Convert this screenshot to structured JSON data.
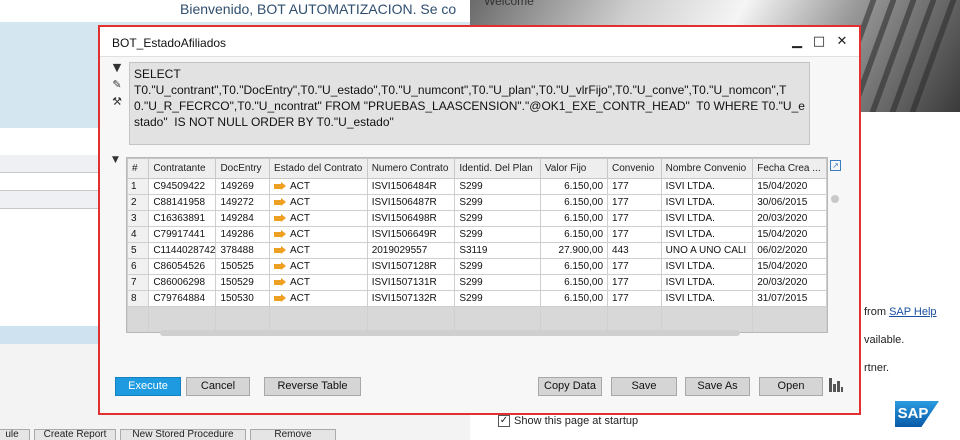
{
  "background": {
    "welcome_text": "Bienvenido, BOT AUTOMATIZACION. Se co",
    "welcome_panel_title": "Welcome",
    "bottom_buttons": [
      "ule",
      "Create Report",
      "New Stored Procedure",
      "Remove"
    ],
    "help_link_prefix": "from",
    "help_link": "SAP Help",
    "line_available": "vailable.",
    "line_partner": "rtner.",
    "show_startup_label": "Show this page at startup",
    "show_startup_checked": true,
    "sap_logo_text": "SAP"
  },
  "dialog": {
    "title": "BOT_EstadoAfiliados",
    "sql": "SELECT\nT0.\"U_contrant\",T0.\"DocEntry\",T0.\"U_estado\",T0.\"U_numcont\",T0.\"U_plan\",T0.\"U_vlrFijo\",T0.\"U_conve\",T0.\"U_nomcon\",T0.\"U_R_FECRCO\",T0.\"U_ncontrat\" FROM \"PRUEBAS_LAASCENSION\".\"@OK1_EXE_CONTR_HEAD\"  T0 WHERE T0.\"U_estado\"  IS NOT NULL ORDER BY T0.\"U_estado\"",
    "grid": {
      "columns": [
        "#",
        "Contratante",
        "DocEntry",
        "Estado del Contrato",
        "Numero Contrato",
        "Identid. Del Plan",
        "Valor Fijo",
        "Convenio",
        "Nombre Convenio",
        "Fecha Crea ..."
      ],
      "rows": [
        [
          "1",
          "C94509422",
          "149269",
          "ACT",
          "ISVI1506484R",
          "S299",
          "6.150,00",
          "177",
          "ISVI LTDA.",
          "15/04/2020"
        ],
        [
          "2",
          "C88141958",
          "149272",
          "ACT",
          "ISVI1506487R",
          "S299",
          "6.150,00",
          "177",
          "ISVI LTDA.",
          "30/06/2015"
        ],
        [
          "3",
          "C16363891",
          "149284",
          "ACT",
          "ISVI1506498R",
          "S299",
          "6.150,00",
          "177",
          "ISVI LTDA.",
          "20/03/2020"
        ],
        [
          "4",
          "C79917441",
          "149286",
          "ACT",
          "ISVI1506649R",
          "S299",
          "6.150,00",
          "177",
          "ISVI LTDA.",
          "15/04/2020"
        ],
        [
          "5",
          "C1144028742",
          "378488",
          "ACT",
          "2019029557",
          "S3119",
          "27.900,00",
          "443",
          "UNO A UNO CALI",
          "06/02/2020"
        ],
        [
          "6",
          "C86054526",
          "150525",
          "ACT",
          "ISVI1507128R",
          "S299",
          "6.150,00",
          "177",
          "ISVI LTDA.",
          "15/04/2020"
        ],
        [
          "7",
          "C86006298",
          "150529",
          "ACT",
          "ISVI1507131R",
          "S299",
          "6.150,00",
          "177",
          "ISVI LTDA.",
          "20/03/2020"
        ],
        [
          "8",
          "C79764884",
          "150530",
          "ACT",
          "ISVI1507132R",
          "S299",
          "6.150,00",
          "177",
          "ISVI LTDA.",
          "31/07/2015"
        ]
      ]
    },
    "buttons": {
      "execute": "Execute",
      "cancel": "Cancel",
      "reverse_table": "Reverse Table",
      "copy_data": "Copy Data",
      "save": "Save",
      "save_as": "Save As",
      "open": "Open"
    },
    "colors": {
      "border": "#e03030",
      "primary_button": "#1e9be0",
      "status_arrow": "#f0a020"
    }
  }
}
